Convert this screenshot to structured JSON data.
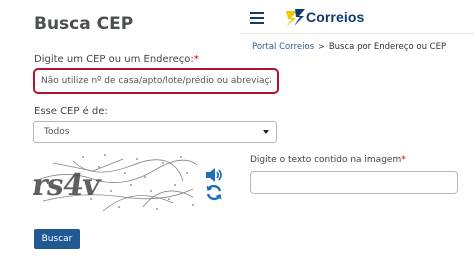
{
  "form": {
    "title": "Busca CEP",
    "address_label": "Digite um CEP ou um Endereço:",
    "required_mark": "*",
    "address_placeholder": "Não utilize nº de casa/apto/lote/prédio ou abreviação.",
    "type_label": "Esse CEP é de:",
    "type_selected": "Todos",
    "captcha_text": "rs4v",
    "submit_label": "Buscar"
  },
  "header": {
    "brand": "Correios"
  },
  "breadcrumb": {
    "home": "Portal Correios",
    "separator": ">",
    "current": "Busca por Endereço ou CEP"
  },
  "captcha": {
    "label": "Digite o texto contido na imagem",
    "required_mark": "*",
    "input_value": ""
  },
  "icons": {
    "menu": "hamburger-menu-icon",
    "audio": "speaker-icon",
    "refresh": "refresh-icon",
    "select_caret": "caret-down-icon"
  },
  "colors": {
    "brand_blue": "#0f3a70",
    "brand_yellow": "#f4c600",
    "input_error_border": "#b5122e",
    "button_bg": "#1f5a93",
    "link": "#2d5f93",
    "icon_blue": "#1e6fb5"
  }
}
